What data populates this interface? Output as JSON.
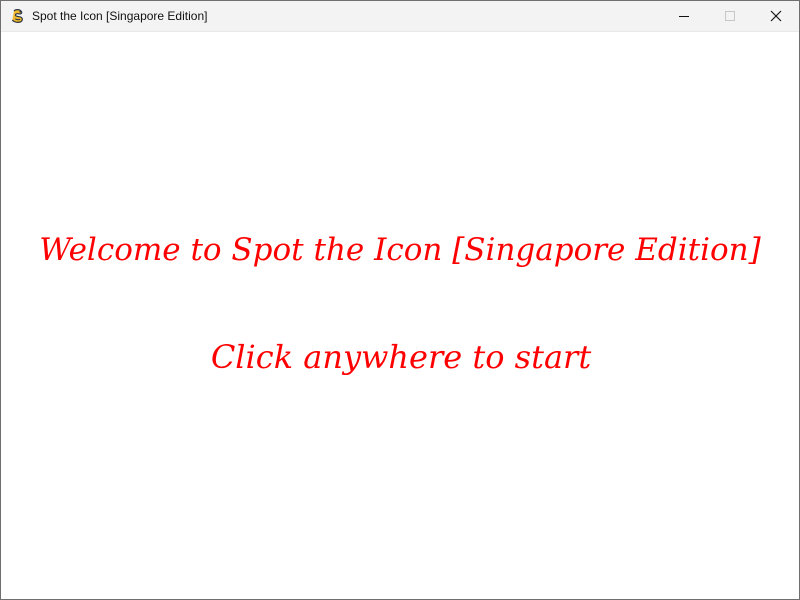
{
  "window": {
    "title": "Spot the Icon [Singapore Edition]",
    "app_icon": "pygame-snake-icon",
    "controls": {
      "minimize_icon": "minimize-icon",
      "maximize_icon": "maximize-icon",
      "close_icon": "close-icon"
    }
  },
  "screen": {
    "welcome_text": "Welcome to Spot the Icon [Singapore Edition]",
    "instruction_text": "Click anywhere to start",
    "text_color": "#ff0000",
    "background_color": "#ffffff"
  }
}
